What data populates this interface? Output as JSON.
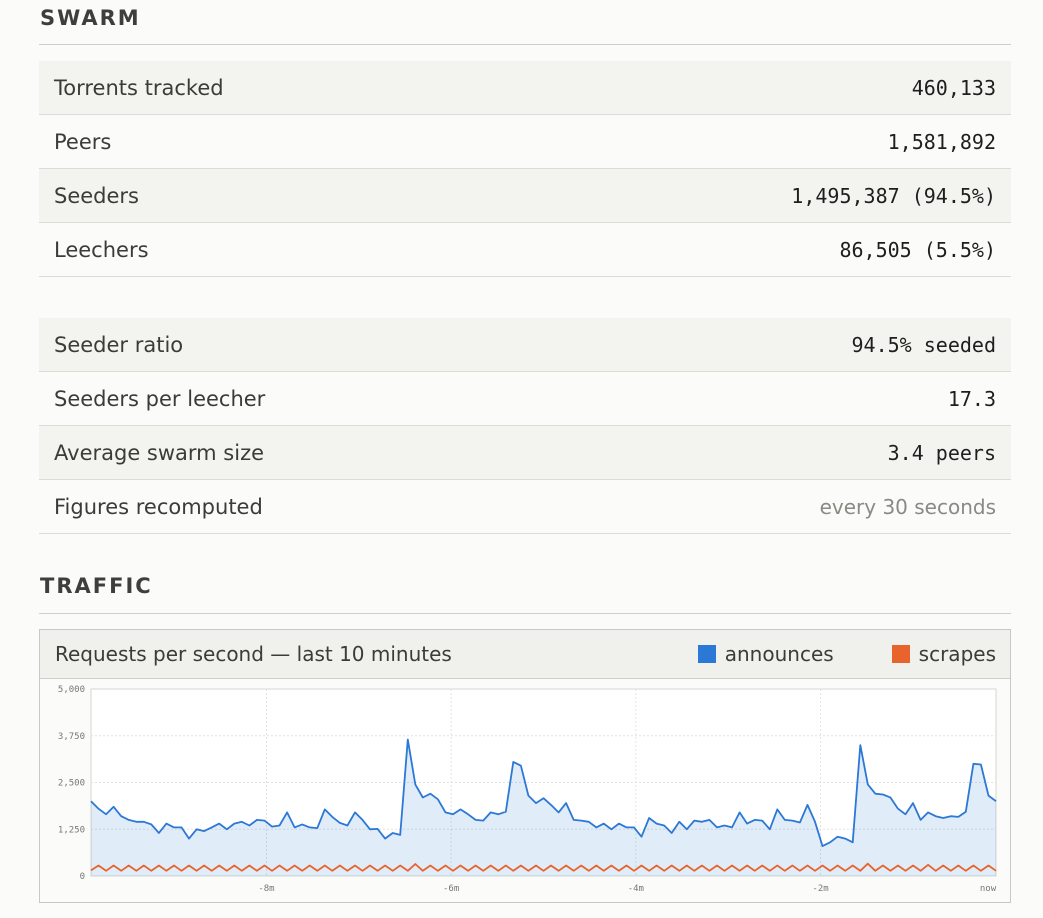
{
  "swarm": {
    "title": "SWARM",
    "rows": [
      {
        "label": "Torrents tracked",
        "value": "460,133"
      },
      {
        "label": "Peers",
        "value": "1,581,892"
      },
      {
        "label": "Seeders",
        "value": "1,495,387 (94.5%)"
      },
      {
        "label": "Leechers",
        "value": "86,505 (5.5%)"
      }
    ],
    "derived": [
      {
        "label": "Seeder ratio",
        "value": "94.5% seeded"
      },
      {
        "label": "Seeders per leecher",
        "value": "17.3"
      },
      {
        "label": "Average swarm size",
        "value": "3.4 peers"
      },
      {
        "label": "Figures recomputed",
        "value": "every 30 seconds"
      }
    ]
  },
  "traffic": {
    "title": "TRAFFIC",
    "chart_title": "Requests per second — last 10 minutes",
    "legend": [
      {
        "label": "announces",
        "color": "#2b78d6"
      },
      {
        "label": "scrapes",
        "color": "#e8642c"
      }
    ]
  },
  "chart_data": {
    "type": "area",
    "title": "Requests per second — last 10 minutes",
    "xlabel": "",
    "ylabel": "",
    "ylim": [
      0,
      5000
    ],
    "yticks": [
      "5,000",
      "3,750",
      "2,500",
      "1,250",
      "0"
    ],
    "xticks": [
      "-8m",
      "-6m",
      "-4m",
      "-2m",
      "now"
    ],
    "grid": true,
    "legend_position": "top-right",
    "series": [
      {
        "name": "announces",
        "color": "#2b78d6",
        "values": [
          2000,
          1800,
          1650,
          1850,
          1600,
          1500,
          1450,
          1450,
          1380,
          1150,
          1400,
          1300,
          1300,
          1000,
          1250,
          1200,
          1300,
          1400,
          1250,
          1400,
          1450,
          1350,
          1500,
          1480,
          1320,
          1350,
          1700,
          1300,
          1380,
          1300,
          1280,
          1780,
          1580,
          1420,
          1350,
          1700,
          1500,
          1250,
          1260,
          1000,
          1150,
          1100,
          3650,
          2450,
          2100,
          2200,
          2050,
          1700,
          1650,
          1780,
          1650,
          1500,
          1480,
          1700,
          1650,
          1720,
          3050,
          2950,
          2150,
          1950,
          2080,
          1900,
          1700,
          1950,
          1500,
          1480,
          1450,
          1300,
          1400,
          1250,
          1400,
          1300,
          1300,
          1050,
          1550,
          1400,
          1350,
          1150,
          1450,
          1250,
          1480,
          1450,
          1500,
          1300,
          1350,
          1300,
          1700,
          1400,
          1500,
          1480,
          1250,
          1780,
          1500,
          1480,
          1430,
          1900,
          1450,
          800,
          900,
          1050,
          1000,
          900,
          3500,
          2450,
          2200,
          2180,
          2100,
          1800,
          1650,
          1950,
          1500,
          1700,
          1600,
          1550,
          1600,
          1580,
          1720,
          3000,
          2980,
          2150,
          2000
        ]
      },
      {
        "name": "scrapes",
        "color": "#e8642c",
        "values": [
          150,
          280,
          140,
          280,
          140,
          280,
          140,
          280,
          140,
          280,
          140,
          280,
          140,
          280,
          140,
          280,
          140,
          280,
          140,
          280,
          140,
          280,
          140,
          280,
          140,
          280,
          140,
          280,
          140,
          280,
          140,
          280,
          140,
          280,
          140,
          280,
          140,
          280,
          140,
          280,
          140,
          280,
          140,
          320,
          140,
          280,
          140,
          280,
          140,
          280,
          140,
          280,
          140,
          280,
          140,
          280,
          140,
          280,
          140,
          280,
          140,
          280,
          140,
          280,
          140,
          280,
          140,
          280,
          140,
          280,
          140,
          280,
          140,
          280,
          140,
          280,
          140,
          280,
          140,
          280,
          140,
          280,
          140,
          280,
          140,
          280,
          140,
          280,
          140,
          280,
          140,
          280,
          140,
          280,
          140,
          280,
          140,
          280,
          140,
          280,
          140,
          280,
          140,
          330,
          140,
          280,
          140,
          280,
          140,
          280,
          140,
          300,
          140,
          280,
          140,
          280,
          140,
          280,
          140,
          280,
          140
        ]
      }
    ]
  }
}
